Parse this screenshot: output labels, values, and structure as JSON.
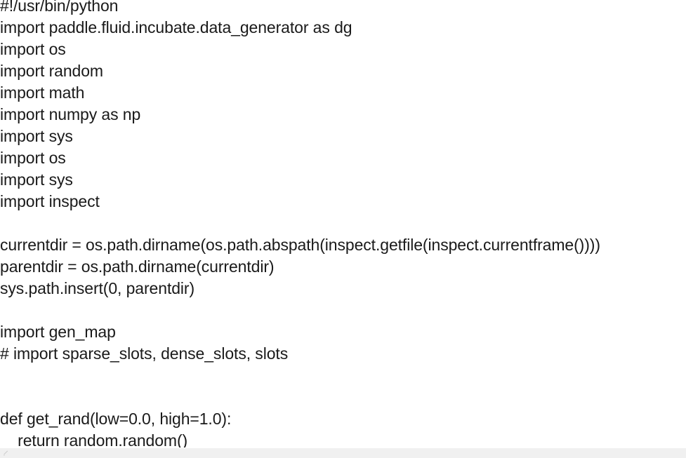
{
  "viewer": {
    "background_color": "#ffffff",
    "text_color": "#1a1a1a",
    "font_size_px": 23,
    "line_height_px": 31
  },
  "document": {
    "language": "python",
    "lines": [
      "#!/usr/bin/python",
      "import paddle.fluid.incubate.data_generator as dg",
      "import os",
      "import random",
      "import math",
      "import numpy as np",
      "import sys",
      "import os",
      "import sys",
      "import inspect",
      "",
      "currentdir = os.path.dirname(os.path.abspath(inspect.getfile(inspect.currentframe())))",
      "parentdir = os.path.dirname(currentdir)",
      "sys.path.insert(0, parentdir)",
      "",
      "import gen_map",
      "# import sparse_slots, dense_slots, slots",
      "",
      "",
      "def get_rand(low=0.0, high=1.0):",
      "    return random.random()"
    ]
  },
  "scrollbar": {
    "orientation": "horizontal",
    "track_color": "#f0f0f0",
    "arrow_color": "#c8c8c8",
    "left_arrow_icon": "chevron-left-icon",
    "thumb_position_percent": 0
  }
}
